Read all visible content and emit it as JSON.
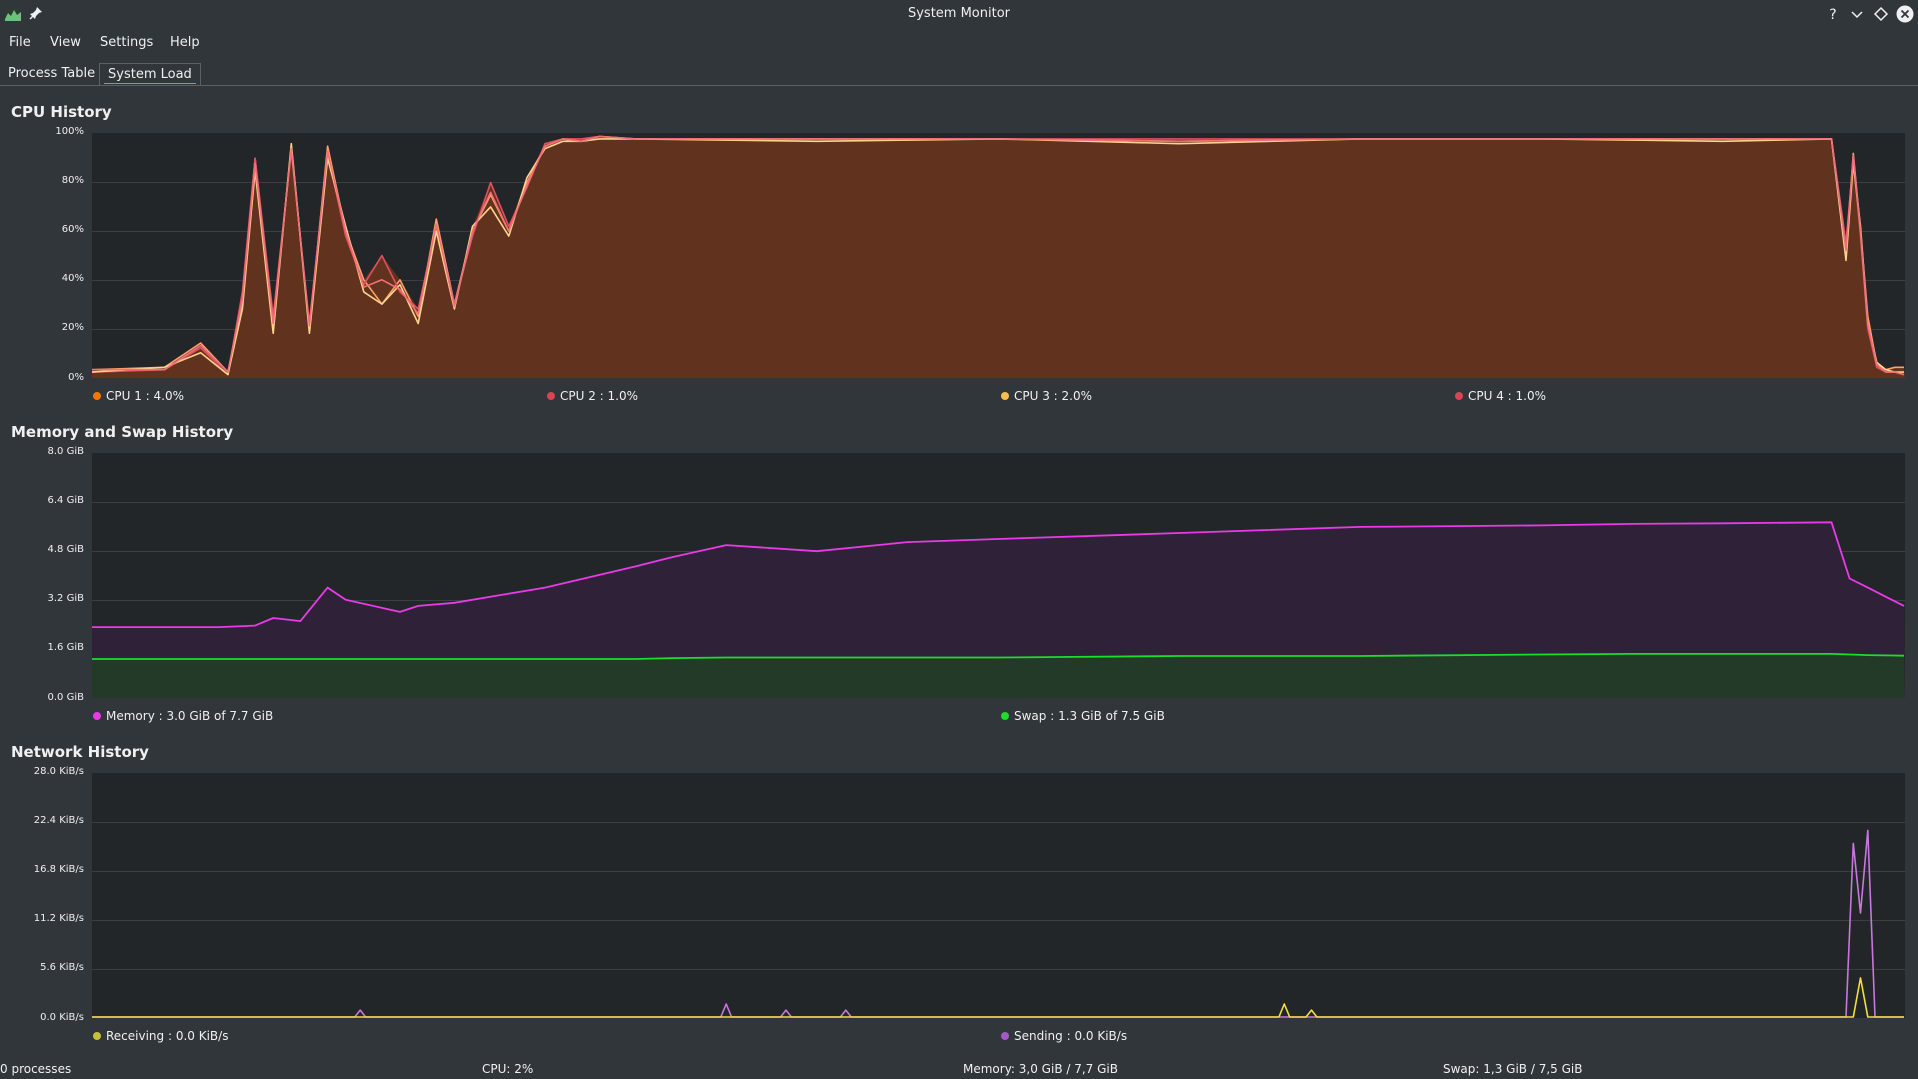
{
  "window": {
    "title": "System Monitor"
  },
  "menu": [
    "File",
    "View",
    "Settings",
    "Help"
  ],
  "tabs": [
    {
      "label": "Process Table",
      "active": false
    },
    {
      "label": "System Load",
      "active": true
    }
  ],
  "colors": {
    "cpu1": "#f67400",
    "cpu2": "#da4453",
    "cpu3": "#fdbc4b",
    "cpu4": "#da4453",
    "memory": "#e93ae9",
    "swap": "#1cdc2c",
    "receiving": "#c9c03a",
    "sending": "#a657c9"
  },
  "cpu": {
    "title": "CPU History",
    "yticks": [
      "100%",
      "80%",
      "60%",
      "40%",
      "20%",
      "0%"
    ],
    "legend": [
      "CPU 1 : 4.0%",
      "CPU 2 : 1.0%",
      "CPU 3 : 2.0%",
      "CPU 4 : 1.0%"
    ]
  },
  "memory": {
    "title": "Memory and Swap History",
    "yticks": [
      "8.0 GiB",
      "6.4 GiB",
      "4.8 GiB",
      "3.2 GiB",
      "1.6 GiB",
      "0.0 GiB"
    ],
    "legend": [
      "Memory : 3.0 GiB of 7.7 GiB",
      "Swap : 1.3 GiB of 7.5 GiB"
    ]
  },
  "network": {
    "title": "Network History",
    "yticks": [
      "28.0 KiB/s",
      "22.4 KiB/s",
      "16.8 KiB/s",
      "11.2 KiB/s",
      "5.6 KiB/s",
      "0.0 KiB/s"
    ],
    "legend": [
      "Receiving : 0.0 KiB/s",
      "Sending : 0.0 KiB/s"
    ]
  },
  "status": {
    "processes": "0 processes",
    "cpu": "CPU: 2%",
    "memory": "Memory: 3,0 GiB / 7,7 GiB",
    "swap": "Swap: 1,3 GiB / 7,5 GiB"
  },
  "chart_data": [
    {
      "type": "area",
      "title": "CPU History",
      "ylim": [
        0,
        100
      ],
      "yunit": "%",
      "x": [
        0,
        0.04,
        0.06,
        0.075,
        0.083,
        0.09,
        0.1,
        0.11,
        0.12,
        0.13,
        0.14,
        0.15,
        0.16,
        0.17,
        0.18,
        0.19,
        0.2,
        0.21,
        0.22,
        0.23,
        0.24,
        0.25,
        0.26,
        0.27,
        0.28,
        0.3,
        0.4,
        0.5,
        0.6,
        0.7,
        0.8,
        0.9,
        0.96,
        0.968,
        0.972,
        0.976,
        0.98,
        0.985,
        0.99,
        0.995,
        1.0
      ],
      "series": [
        {
          "name": "CPU 1",
          "values": [
            3,
            4,
            14,
            2,
            30,
            90,
            20,
            95,
            20,
            95,
            60,
            40,
            30,
            40,
            25,
            65,
            30,
            60,
            75,
            60,
            80,
            95,
            98,
            97,
            99,
            98,
            98,
            98,
            97,
            98,
            98,
            98,
            98,
            50,
            92,
            60,
            25,
            5,
            3,
            4,
            4
          ]
        },
        {
          "name": "CPU 2",
          "values": [
            2,
            3,
            12,
            1,
            35,
            90,
            25,
            93,
            22,
            92,
            58,
            38,
            50,
            35,
            28,
            62,
            30,
            58,
            80,
            62,
            78,
            96,
            98,
            98,
            99,
            98,
            98,
            98,
            98,
            98,
            98,
            98,
            98,
            55,
            90,
            58,
            20,
            4,
            2,
            2,
            1
          ]
        },
        {
          "name": "CPU 3",
          "values": [
            2,
            4,
            10,
            1,
            28,
            85,
            18,
            96,
            18,
            90,
            62,
            35,
            30,
            38,
            22,
            60,
            28,
            62,
            70,
            58,
            82,
            94,
            97,
            97,
            98,
            98,
            97,
            98,
            96,
            98,
            98,
            97,
            98,
            48,
            88,
            62,
            22,
            6,
            3,
            2,
            2
          ]
        },
        {
          "name": "CPU 4",
          "values": [
            3,
            3,
            13,
            2,
            32,
            88,
            22,
            94,
            21,
            93,
            60,
            37,
            40,
            36,
            26,
            63,
            29,
            60,
            76,
            60,
            79,
            95,
            98,
            97,
            99,
            98,
            98,
            98,
            97,
            98,
            98,
            98,
            98,
            52,
            91,
            60,
            22,
            5,
            2,
            2,
            1
          ]
        }
      ]
    },
    {
      "type": "area",
      "title": "Memory and Swap History",
      "ylim": [
        0,
        8.0
      ],
      "yunit": "GiB",
      "x": [
        0,
        0.07,
        0.09,
        0.1,
        0.115,
        0.13,
        0.14,
        0.17,
        0.18,
        0.2,
        0.25,
        0.3,
        0.32,
        0.35,
        0.4,
        0.45,
        0.5,
        0.6,
        0.7,
        0.8,
        0.85,
        0.9,
        0.96,
        0.97,
        0.98,
        0.99,
        1.0
      ],
      "series": [
        {
          "name": "Memory",
          "values": [
            2.3,
            2.3,
            2.35,
            2.6,
            2.5,
            3.6,
            3.2,
            2.8,
            3.0,
            3.1,
            3.6,
            4.3,
            4.6,
            5.0,
            4.8,
            5.1,
            5.2,
            5.4,
            5.6,
            5.65,
            5.7,
            5.72,
            5.75,
            3.9,
            3.6,
            3.3,
            3.0
          ]
        },
        {
          "name": "Swap",
          "values": [
            1.25,
            1.25,
            1.25,
            1.25,
            1.25,
            1.25,
            1.25,
            1.25,
            1.25,
            1.25,
            1.25,
            1.25,
            1.28,
            1.3,
            1.3,
            1.3,
            1.3,
            1.35,
            1.35,
            1.4,
            1.42,
            1.42,
            1.42,
            1.4,
            1.38,
            1.37,
            1.36
          ]
        }
      ]
    },
    {
      "type": "line",
      "title": "Network History",
      "ylim": [
        0,
        28.0
      ],
      "yunit": "KiB/s",
      "x": [
        0,
        0.145,
        0.148,
        0.151,
        0.347,
        0.35,
        0.353,
        0.38,
        0.383,
        0.386,
        0.413,
        0.416,
        0.419,
        0.655,
        0.658,
        0.661,
        0.67,
        0.673,
        0.676,
        0.968,
        0.972,
        0.976,
        0.98,
        0.984,
        0.988,
        1.0
      ],
      "series": [
        {
          "name": "Receiving",
          "values": [
            0,
            0,
            0,
            0,
            0,
            0,
            0,
            0,
            0,
            0,
            0,
            0,
            0,
            0,
            1.5,
            0,
            0,
            0.8,
            0,
            0,
            0,
            4.5,
            0,
            0,
            0,
            0
          ]
        },
        {
          "name": "Sending",
          "values": [
            0,
            0,
            0.8,
            0,
            0,
            1.5,
            0,
            0,
            0.8,
            0,
            0,
            0.8,
            0,
            0,
            0,
            0,
            0,
            0,
            0,
            0,
            20,
            12,
            21.5,
            0,
            0,
            0
          ]
        }
      ]
    }
  ]
}
